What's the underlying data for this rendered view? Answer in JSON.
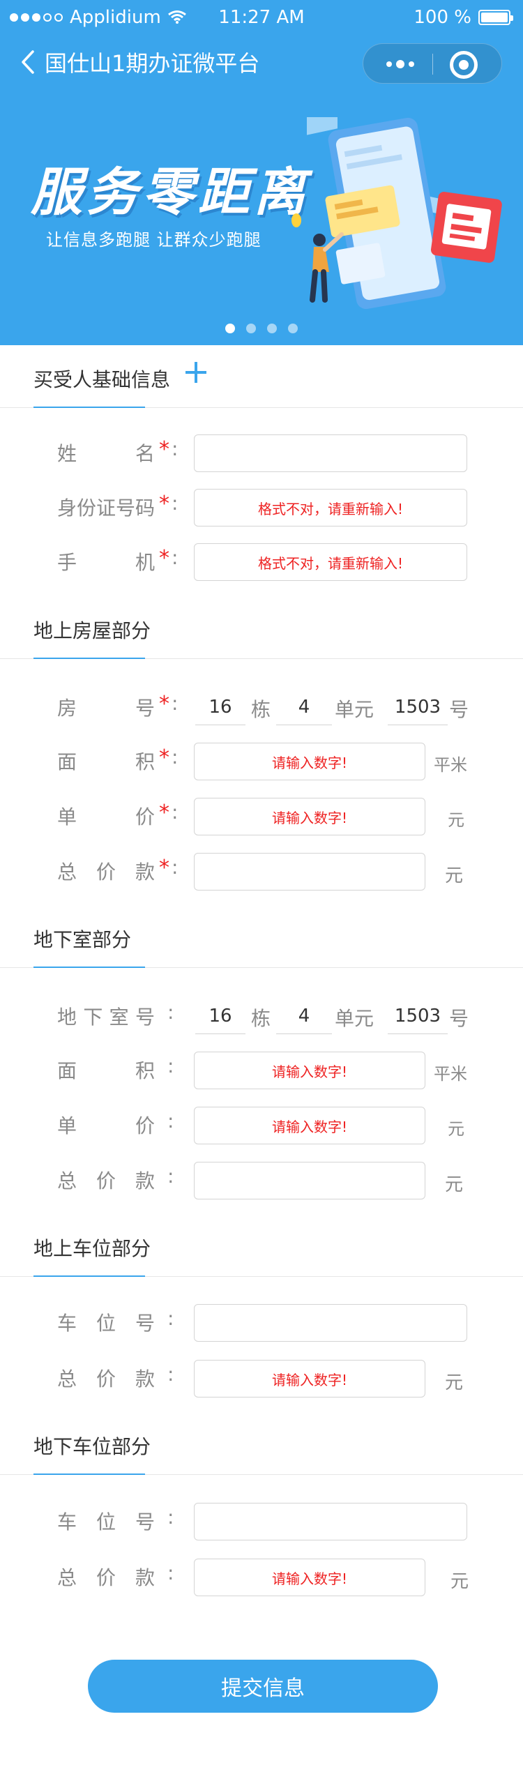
{
  "status_bar": {
    "carrier": "Applidium",
    "time": "11:27 AM",
    "battery": "100 %",
    "battery_level": 1.0
  },
  "nav": {
    "title": "国仕山1期办证微平台"
  },
  "banner": {
    "title": "服务零距离",
    "subtitle": "让信息多跑腿 让群众少跑腿",
    "slide_count": 4,
    "active_slide": 1
  },
  "sections": {
    "buyer": {
      "title": "买受人基础信息",
      "name_label": "姓名",
      "id_label": "身份证号码",
      "phone_label": "手机",
      "id_error": "格式不对，请重新输入!",
      "phone_error": "格式不对，请重新输入!"
    },
    "house": {
      "title": "地上房屋部分",
      "room_label": "房号",
      "building": "16",
      "building_unit": "栋",
      "unit_no": "4",
      "unit_unit": "单元",
      "room_no": "1503",
      "room_unit": "号",
      "area_label": "面积",
      "area_error": "请输入数字!",
      "area_unit": "平米",
      "price_label": "单价",
      "price_error": "请输入数字!",
      "price_unit": "元",
      "total_label": "总价款",
      "total_unit": "元"
    },
    "basement": {
      "title": "地下室部分",
      "no_label": "地下室号",
      "building": "16",
      "building_unit": "栋",
      "unit_no": "4",
      "unit_unit": "单元",
      "room_no": "1503",
      "room_unit": "号",
      "area_label": "面积",
      "area_error": "请输入数字!",
      "area_unit": "平米",
      "price_label": "单价",
      "price_error": "请输入数字!",
      "price_unit": "元",
      "total_label": "总价款",
      "total_unit": "元"
    },
    "ground_parking": {
      "title": "地上车位部分",
      "no_label": "车位号",
      "total_label": "总价款",
      "total_error": "请输入数字!",
      "total_unit": "元"
    },
    "underground_parking": {
      "title": "地下车位部分",
      "no_label": "车位号",
      "total_label": "总价款",
      "total_error": "请输入数字!",
      "total_unit": "元"
    }
  },
  "required_mark": "*",
  "colon": ":",
  "submit_label": "提交信息"
}
